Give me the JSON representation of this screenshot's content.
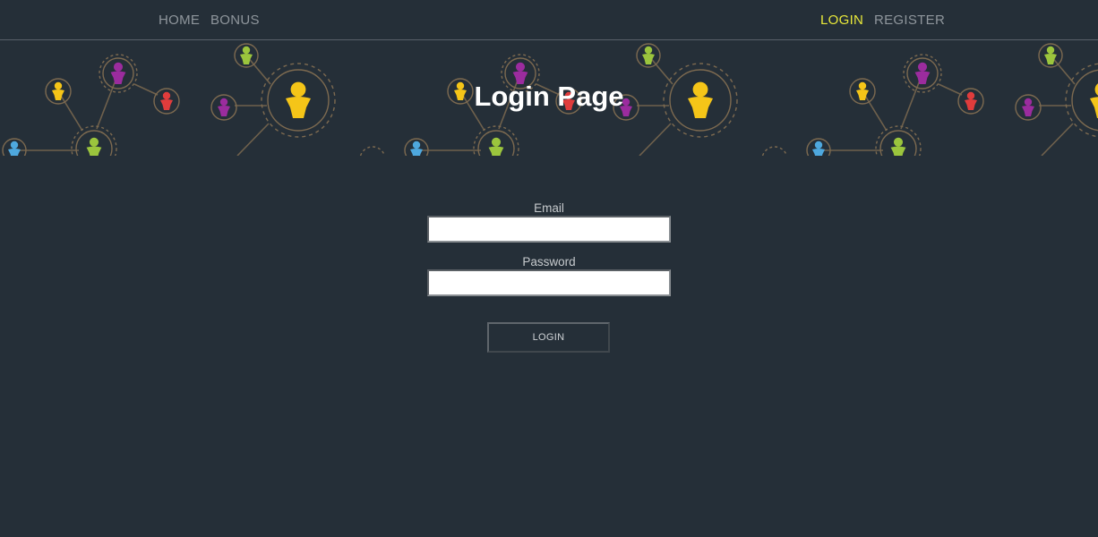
{
  "nav": {
    "home": "HOME",
    "bonus": "BONUS",
    "login": "LOGIN",
    "register": "REGISTER",
    "active_color": "#e8e83a",
    "link_color": "#8f969c"
  },
  "hero": {
    "title": "Login Page",
    "pattern_colors": {
      "yellow": "#f5c518",
      "purple": "#9b2c9e",
      "red": "#e03c3c",
      "green": "#9bc53d",
      "blue": "#4ea8de",
      "line": "#7d6a50"
    }
  },
  "form": {
    "email_label": "Email",
    "email_value": "",
    "password_label": "Password",
    "password_value": "",
    "submit_label": "LOGIN"
  },
  "colors": {
    "background": "#252f38",
    "title": "#ffffff"
  }
}
